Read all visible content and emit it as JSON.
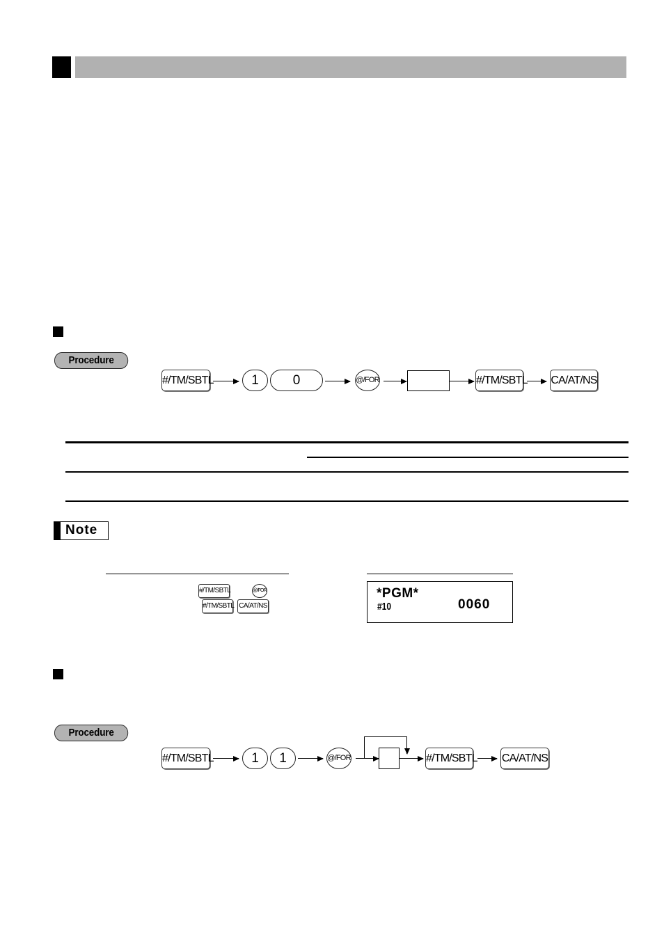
{
  "page": {
    "section_header": {
      "title": ""
    },
    "section1": {
      "heading": "",
      "procedure_label": "Procedure",
      "sequence": [
        {
          "type": "key",
          "label": "#/TM/SBTL",
          "icon": "subtotal-key"
        },
        {
          "type": "num",
          "label": "1"
        },
        {
          "type": "num-wide",
          "label": "0"
        },
        {
          "type": "round",
          "label": "@/FOR",
          "icon": "for-key"
        },
        {
          "type": "input-box",
          "label": ""
        },
        {
          "type": "key",
          "label": "#/TM/SBTL",
          "icon": "subtotal-key"
        },
        {
          "type": "key",
          "label": "CA/AT/NS",
          "icon": "cash-key"
        }
      ],
      "table": {
        "headers": [],
        "rows": []
      }
    },
    "note": {
      "label": "Note",
      "keys": {
        "row1_key1": "#/TM/SBTL",
        "row1_key2": "@/FOR",
        "row2_key1": "#/TM/SBTL",
        "row2_key2": "CA/AT/NS"
      },
      "display": {
        "line1": "*PGM*",
        "line2_label": "#10",
        "line2_value": "0060"
      }
    },
    "section2": {
      "heading": "",
      "procedure_label": "Procedure",
      "sequence": [
        {
          "type": "key",
          "label": "#/TM/SBTL",
          "icon": "subtotal-key"
        },
        {
          "type": "num",
          "label": "1"
        },
        {
          "type": "num",
          "label": "1"
        },
        {
          "type": "round",
          "label": "@/FOR",
          "icon": "for-key"
        },
        {
          "type": "input-box-loop",
          "label": ""
        },
        {
          "type": "key",
          "label": "#/TM/SBTL",
          "icon": "subtotal-key"
        },
        {
          "type": "key",
          "label": "CA/AT/NS",
          "icon": "cash-key"
        }
      ]
    }
  }
}
